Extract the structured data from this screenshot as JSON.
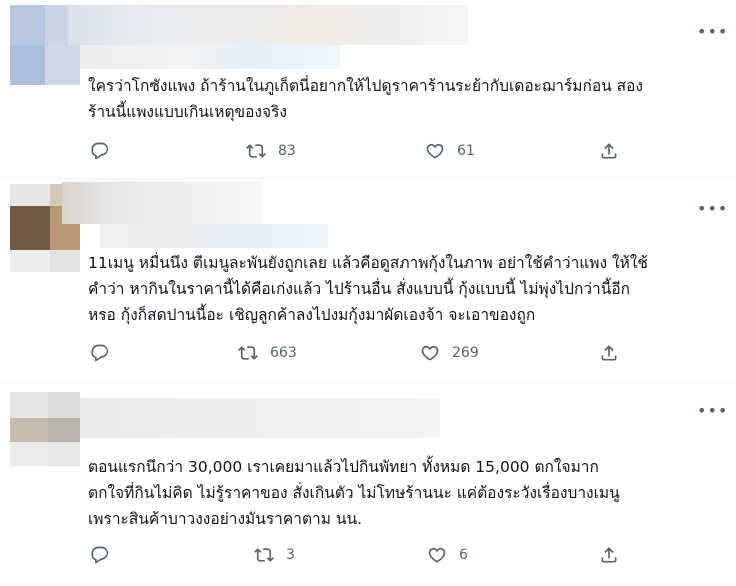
{
  "tweets": [
    {
      "text": "ใครว่าโกซังแพง ถ้าร้านในภูเก็ตนี่อยากให้ไปดูราคาร้านระย้ากับเดอะฌาร์มก่อน สอง\nร้านนี้แพงแบบเกินเหตุของจริง",
      "replies": "",
      "retweets": "83",
      "likes": "61"
    },
    {
      "text": "11เมนู หมื่นนึง ตีเมนูละพันยังถูกเลย แล้วคือดูสภาพกุ้งในภาพ อย่าใช้คำว่าแพง ให้ใช้\nคำว่า หากินในราคานี้ได้คือเก่งแล้ว ไปร้านอื่น สั่งแบบนี้ กุ้งแบบนี้ ไม่พุ่งไปกว่านี้อีก\nหรอ กุ้งก็สดปานนี้อะ เชิญลูกค้าลงไปงมกุ้งมาผัดเองจ้า จะเอาของถูก",
      "replies": "",
      "retweets": "663",
      "likes": "269"
    },
    {
      "text": "ตอนแรกนึกว่า 30,000  เราเคยมาแล้วไปกินพัทยา  ทั้งหมด 15,000 ตกใจมาก\nตกใจที่กินไม่คิด ไม่รู้ราคาของ สั่งเกินตัว ไม่โทษร้านนะ แค่ต้องระวังเรื่องบางเมนู\nเพราะสินค้าบาวงงอย่างมันราคาตาม นน.",
      "replies": "",
      "retweets": "3",
      "likes": "6"
    }
  ],
  "more_label": "•••",
  "icons": {
    "reply": "reply-icon",
    "retweet": "retweet-icon",
    "like": "heart-icon",
    "share": "share-icon"
  },
  "colors": {
    "text": "#0f1419",
    "muted": "#536471",
    "divider": "#eff3f4"
  }
}
